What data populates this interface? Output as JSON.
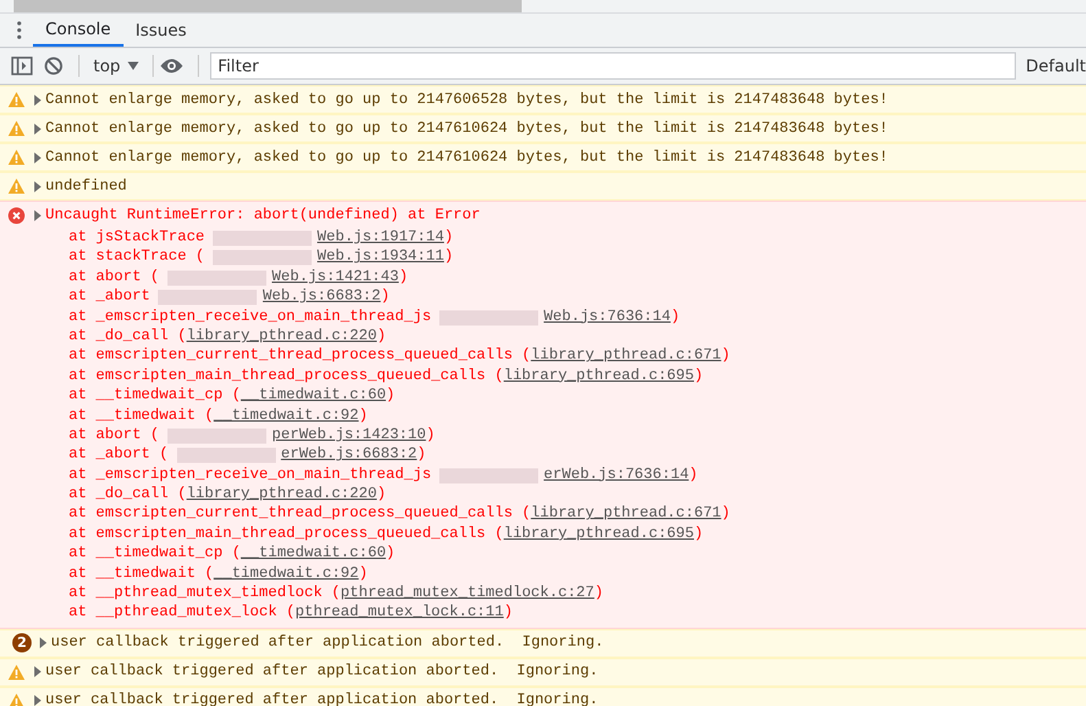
{
  "tabs": [
    {
      "label": "Console",
      "selected": true
    },
    {
      "label": "Issues",
      "selected": false
    }
  ],
  "toolbar": {
    "context": "top",
    "filter_placeholder": "Filter",
    "levels": "Default"
  },
  "messages": [
    {
      "kind": "warning",
      "text": "Cannot enlarge memory, asked to go up to 2147606528 bytes, but the limit is 2147483648 bytes!"
    },
    {
      "kind": "warning",
      "text": "Cannot enlarge memory, asked to go up to 2147610624 bytes, but the limit is 2147483648 bytes!"
    },
    {
      "kind": "warning",
      "text": "Cannot enlarge memory, asked to go up to 2147610624 bytes, but the limit is 2147483648 bytes!"
    },
    {
      "kind": "warning",
      "text": "undefined"
    },
    {
      "kind": "error",
      "text": "Uncaught RuntimeError: abort(undefined) at Error",
      "frames": [
        {
          "text": "at jsStackTrace",
          "redacted": true,
          "link": "Web.js:1917:14",
          "close": ")"
        },
        {
          "text": "at stackTrace (",
          "redacted": true,
          "link": "Web.js:1934:11",
          "close": ")"
        },
        {
          "text": "at abort (",
          "redacted": true,
          "link": "Web.js:1421:43",
          "close": ")"
        },
        {
          "text": "at _abort",
          "redacted": true,
          "link": "Web.js:6683:2",
          "close": ")"
        },
        {
          "text": "at _emscripten_receive_on_main_thread_js",
          "redacted": true,
          "link": "Web.js:7636:14",
          "close": ")"
        },
        {
          "text": "at _do_call (",
          "redacted": false,
          "link": "library_pthread.c:220",
          "close": ")"
        },
        {
          "text": "at emscripten_current_thread_process_queued_calls (",
          "redacted": false,
          "link": "library_pthread.c:671",
          "close": ")"
        },
        {
          "text": "at emscripten_main_thread_process_queued_calls (",
          "redacted": false,
          "link": "library_pthread.c:695",
          "close": ")"
        },
        {
          "text": "at __timedwait_cp (",
          "redacted": false,
          "link": "__timedwait.c:60",
          "close": ")"
        },
        {
          "text": "at __timedwait (",
          "redacted": false,
          "link": "__timedwait.c:92",
          "close": ")"
        },
        {
          "text": "at abort (",
          "redacted": true,
          "link": "perWeb.js:1423:10",
          "close": ")"
        },
        {
          "text": "at _abort (",
          "redacted": true,
          "link": "erWeb.js:6683:2",
          "close": ")"
        },
        {
          "text": "at _emscripten_receive_on_main_thread_js",
          "redacted": true,
          "link": "erWeb.js:7636:14",
          "close": ")"
        },
        {
          "text": "at _do_call (",
          "redacted": false,
          "link": "library_pthread.c:220",
          "close": ")"
        },
        {
          "text": "at emscripten_current_thread_process_queued_calls (",
          "redacted": false,
          "link": "library_pthread.c:671",
          "close": ")"
        },
        {
          "text": "at emscripten_main_thread_process_queued_calls (",
          "redacted": false,
          "link": "library_pthread.c:695",
          "close": ")"
        },
        {
          "text": "at __timedwait_cp (",
          "redacted": false,
          "link": "__timedwait.c:60",
          "close": ")"
        },
        {
          "text": "at __timedwait (",
          "redacted": false,
          "link": "__timedwait.c:92",
          "close": ")"
        },
        {
          "text": "at __pthread_mutex_timedlock (",
          "redacted": false,
          "link": "pthread_mutex_timedlock.c:27",
          "close": ")"
        },
        {
          "text": "at __pthread_mutex_lock (",
          "redacted": false,
          "link": "pthread_mutex_lock.c:11",
          "close": ")"
        }
      ]
    },
    {
      "kind": "warning",
      "count": "2",
      "text": "user callback triggered after application aborted.  Ignoring."
    },
    {
      "kind": "warning",
      "text": "user callback triggered after application aborted.  Ignoring."
    },
    {
      "kind": "warning",
      "text": "user callback triggered after application aborted.  Ignoring."
    }
  ]
}
